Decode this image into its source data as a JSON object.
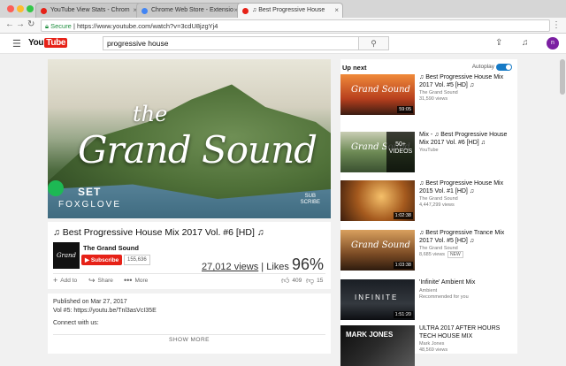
{
  "browser": {
    "tabs": [
      {
        "label": "YouTube View Stats - Chrom"
      },
      {
        "label": "Chrome Web Store - Extensio"
      },
      {
        "label": "♫ Best Progressive House"
      }
    ],
    "secure_label": "Secure",
    "url": "https://www.youtube.com/watch?v=3cdU8jzgYj4"
  },
  "youtube": {
    "logo_you": "You",
    "logo_tube": "Tube",
    "search_value": "progressive house",
    "avatar_letter": "n"
  },
  "player": {
    "overlay_the": "the",
    "overlay_title": "Grand Sound",
    "set_label": "SET",
    "artist": "FOXGLOVE",
    "watermark": "SUB\nSCRIBE"
  },
  "video": {
    "title": "♫ Best Progressive House Mix 2017 Vol. #6 [HD] ♫",
    "channel_logo_text": "Grand Sound",
    "channel": "The Grand Sound",
    "subscribe_label": "Subscribe",
    "subscriber_count": "155,636",
    "views": "27,012 views",
    "likes_label": "Likes",
    "likes_percent": "96%",
    "add_to": "Add to",
    "share": "Share",
    "more": "More",
    "like_count": "409",
    "dislike_count": "15"
  },
  "description": {
    "published": "Published on Mar 27, 2017",
    "vol_line": "Vol #5: https://youtu.be/Tnl3asVcI35E",
    "connect": "Connect with us:",
    "show_more": "SHOW MORE"
  },
  "sidebar": {
    "up_next": "Up next",
    "autoplay": "Autoplay",
    "items": [
      {
        "title": "♫ Best Progressive House Mix 2017 Vol. #5 [HD] ♫",
        "channel": "The Grand Sound",
        "views": "31,590 views",
        "duration": "59:05",
        "thumb_text": "Grand Sound"
      },
      {
        "title": "Mix - ♫ Best Progressive House Mix 2017 Vol. #6 [HD] ♫",
        "channel": "YouTube",
        "views": "",
        "duration": "",
        "playlist_count": "50+",
        "playlist_label": "VIDEOS",
        "thumb_text": "Grand Sound"
      },
      {
        "title": "♫ Best Progressive House Mix 2015 Vol. #1 [HD] ♫",
        "channel": "The Grand Sound",
        "views": "4,447,299 views",
        "duration": "1:02:38",
        "thumb_text": ""
      },
      {
        "title": "♫ Best Progressive Trance Mix 2017 Vol. #5 [HD] ♫",
        "channel": "The Grand Sound",
        "views": "8,685 views",
        "badge": "NEW",
        "duration": "1:03:38",
        "thumb_text": "Grand Sound"
      },
      {
        "title": "'Infinite' Ambient Mix",
        "channel": "Ambient",
        "views": "Recommended for you",
        "duration": "1:51:20",
        "thumb_text": "INFINITE"
      },
      {
        "title": "ULTRA 2017 AFTER HOURS TECH HOUSE MIX",
        "channel": "Mark Jones",
        "views": "48,569 views",
        "duration": "",
        "thumb_text": "MARK JONES"
      }
    ]
  },
  "colors": {
    "youtube_red": "#e62117",
    "link_blue": "#167ac6"
  }
}
